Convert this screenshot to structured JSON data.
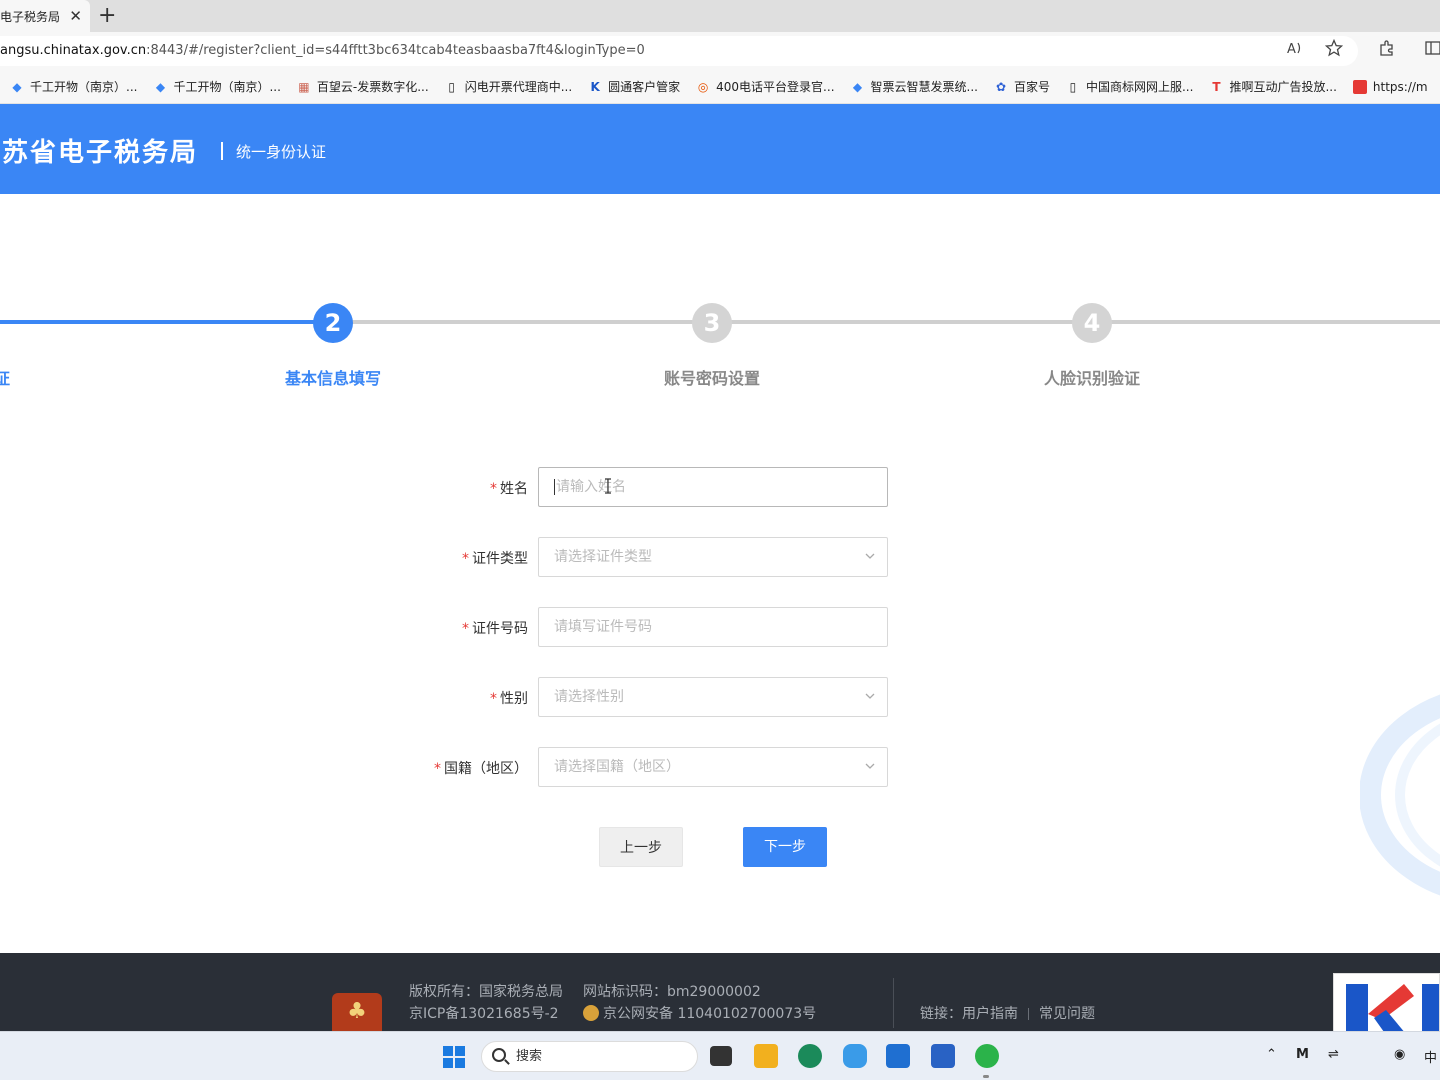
{
  "browser": {
    "tab_title": "电子税务局",
    "tab_close": "✕",
    "new_tab": "+",
    "url_host": "angsu.chinatax.gov.cn",
    "url_rest": ":8443/#/register?client_id=s44fftt3bc634tcab4teasbaasba7ft4&loginType=0",
    "bookmarks": [
      {
        "label": "千工开物（南京）...",
        "icon": "bookmark-icon"
      },
      {
        "label": "千工开物（南京）...",
        "icon": "bookmark-icon"
      },
      {
        "label": "百望云-发票数字化...",
        "icon": "bookmark-icon"
      },
      {
        "label": "闪电开票代理商中...",
        "icon": "page-icon"
      },
      {
        "label": "圆通客户管家",
        "icon": "k-icon"
      },
      {
        "label": "400电话平台登录官...",
        "icon": "phone-icon"
      },
      {
        "label": "智票云智慧发票统...",
        "icon": "bookmark-icon"
      },
      {
        "label": "百家号",
        "icon": "paw-icon"
      },
      {
        "label": "中国商标网网上服...",
        "icon": "page-icon"
      },
      {
        "label": "推啊互动广告投放...",
        "icon": "t-icon"
      },
      {
        "label": "https://m",
        "icon": "red-icon"
      }
    ]
  },
  "header": {
    "title": "江苏省电子税务局",
    "subtitle": "统一身份认证"
  },
  "steps": {
    "prev_label": "证",
    "items": [
      {
        "num": "2",
        "label": "基本信息填写",
        "state": "active"
      },
      {
        "num": "3",
        "label": "账号密码设置",
        "state": "inactive"
      },
      {
        "num": "4",
        "label": "人脸识别验证",
        "state": "inactive"
      }
    ]
  },
  "form": {
    "required_mark": "*",
    "name_label": "姓名",
    "name_placeholder": "请输入姓名",
    "idtype_label": "证件类型",
    "idtype_placeholder": "请选择证件类型",
    "idnum_label": "证件号码",
    "idnum_placeholder": "请填写证件号码",
    "gender_label": "性别",
    "gender_placeholder": "请选择性别",
    "nation_label": "国籍（地区）",
    "nation_placeholder": "请选择国籍（地区）",
    "prev_button": "上一步",
    "next_button": "下一步"
  },
  "footer": {
    "copyright": "版权所有：国家税务总局",
    "site_code": "网站标识码：bm29000002",
    "icp": "京ICP备13021685号-2",
    "police": "京公网安备 11040102700073号",
    "links_label": "链接：",
    "link1": "用户指南",
    "link2": "常见问题"
  },
  "taskbar": {
    "search_placeholder": "搜索",
    "ime": "中"
  },
  "colors": {
    "brand_blue": "#3a86f5",
    "footer_bg": "#2a2f37",
    "required_red": "#e53935"
  }
}
